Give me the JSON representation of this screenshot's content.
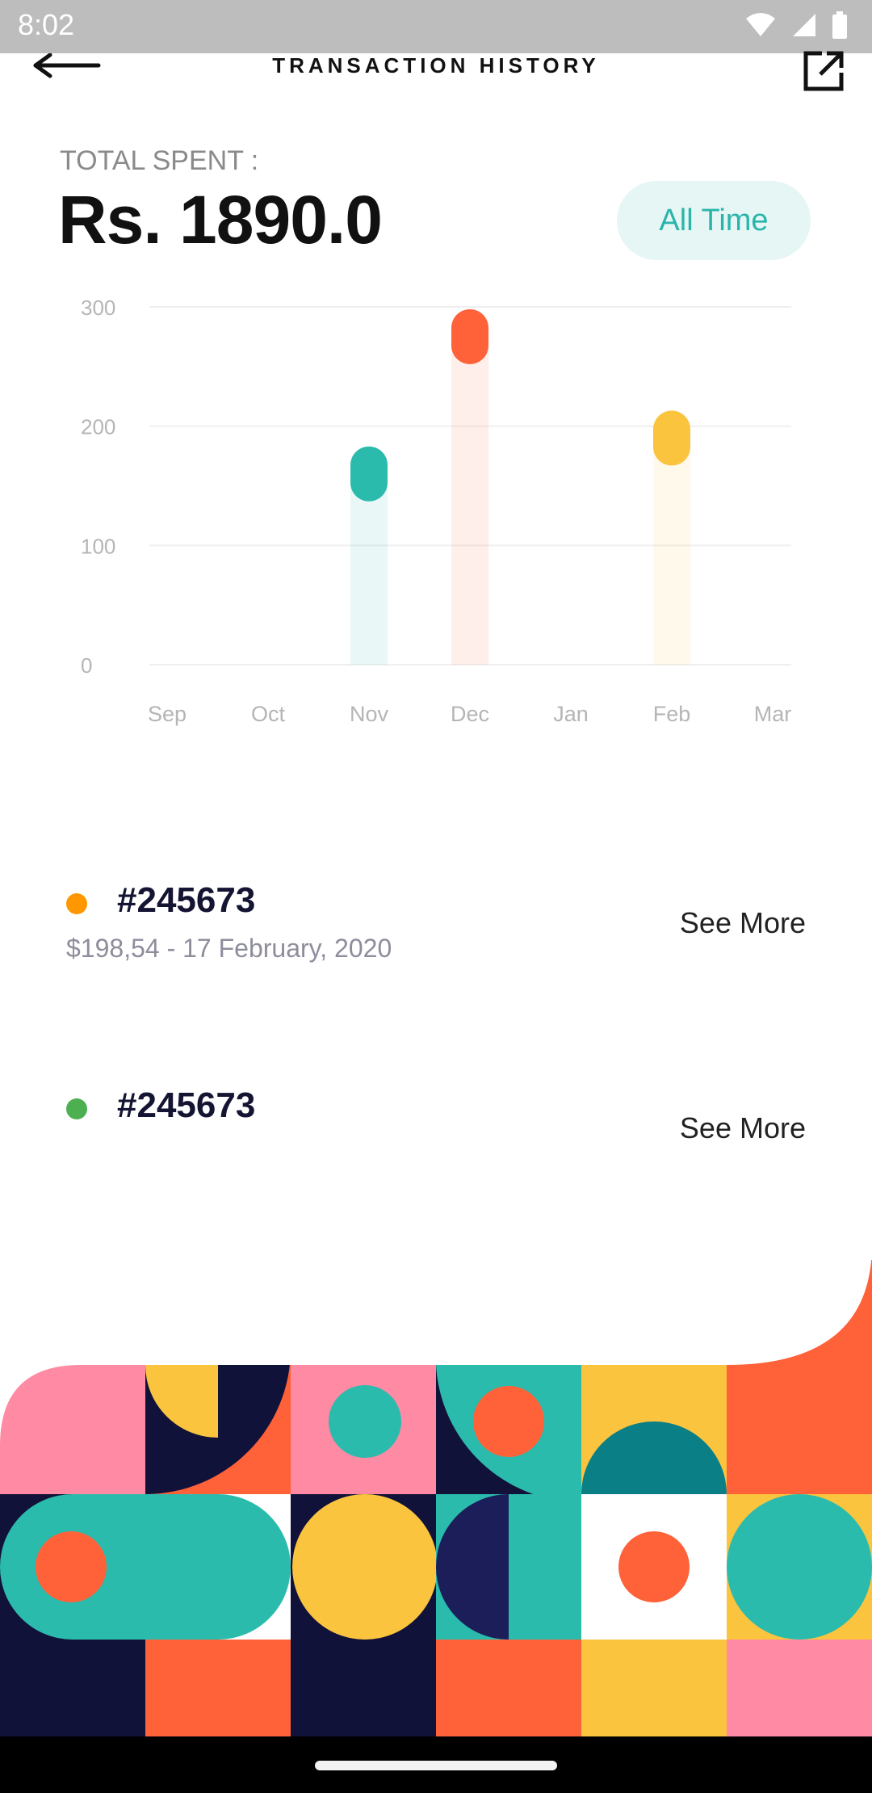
{
  "status": {
    "time": "8:02"
  },
  "header": {
    "title": "TRANSACTION HISTORY"
  },
  "summary": {
    "label": "TOTAL SPENT :",
    "amount": "Rs. 1890.0",
    "range_button": "All Time"
  },
  "chart_data": {
    "type": "bar",
    "categories": [
      "Sep",
      "Oct",
      "Nov",
      "Dec",
      "Jan",
      "Feb",
      "Mar"
    ],
    "values": [
      0,
      0,
      160,
      275,
      0,
      190,
      0
    ],
    "colors": [
      "#2bbbad",
      "#2bbbad",
      "#2bbbad",
      "#ff6138",
      "#2bbbad",
      "#fbc43f",
      "#2bbbad"
    ],
    "yticks": [
      0,
      100,
      200,
      300
    ],
    "ylim": [
      0,
      300
    ],
    "grid": true
  },
  "transactions": [
    {
      "id": "#245673",
      "detail": "$198,54 - 17 February, 2020",
      "action": "See More",
      "dot_color": "#ff9800"
    },
    {
      "id": "#245673",
      "detail": "",
      "action": "See More",
      "dot_color": "#4caf50"
    }
  ]
}
